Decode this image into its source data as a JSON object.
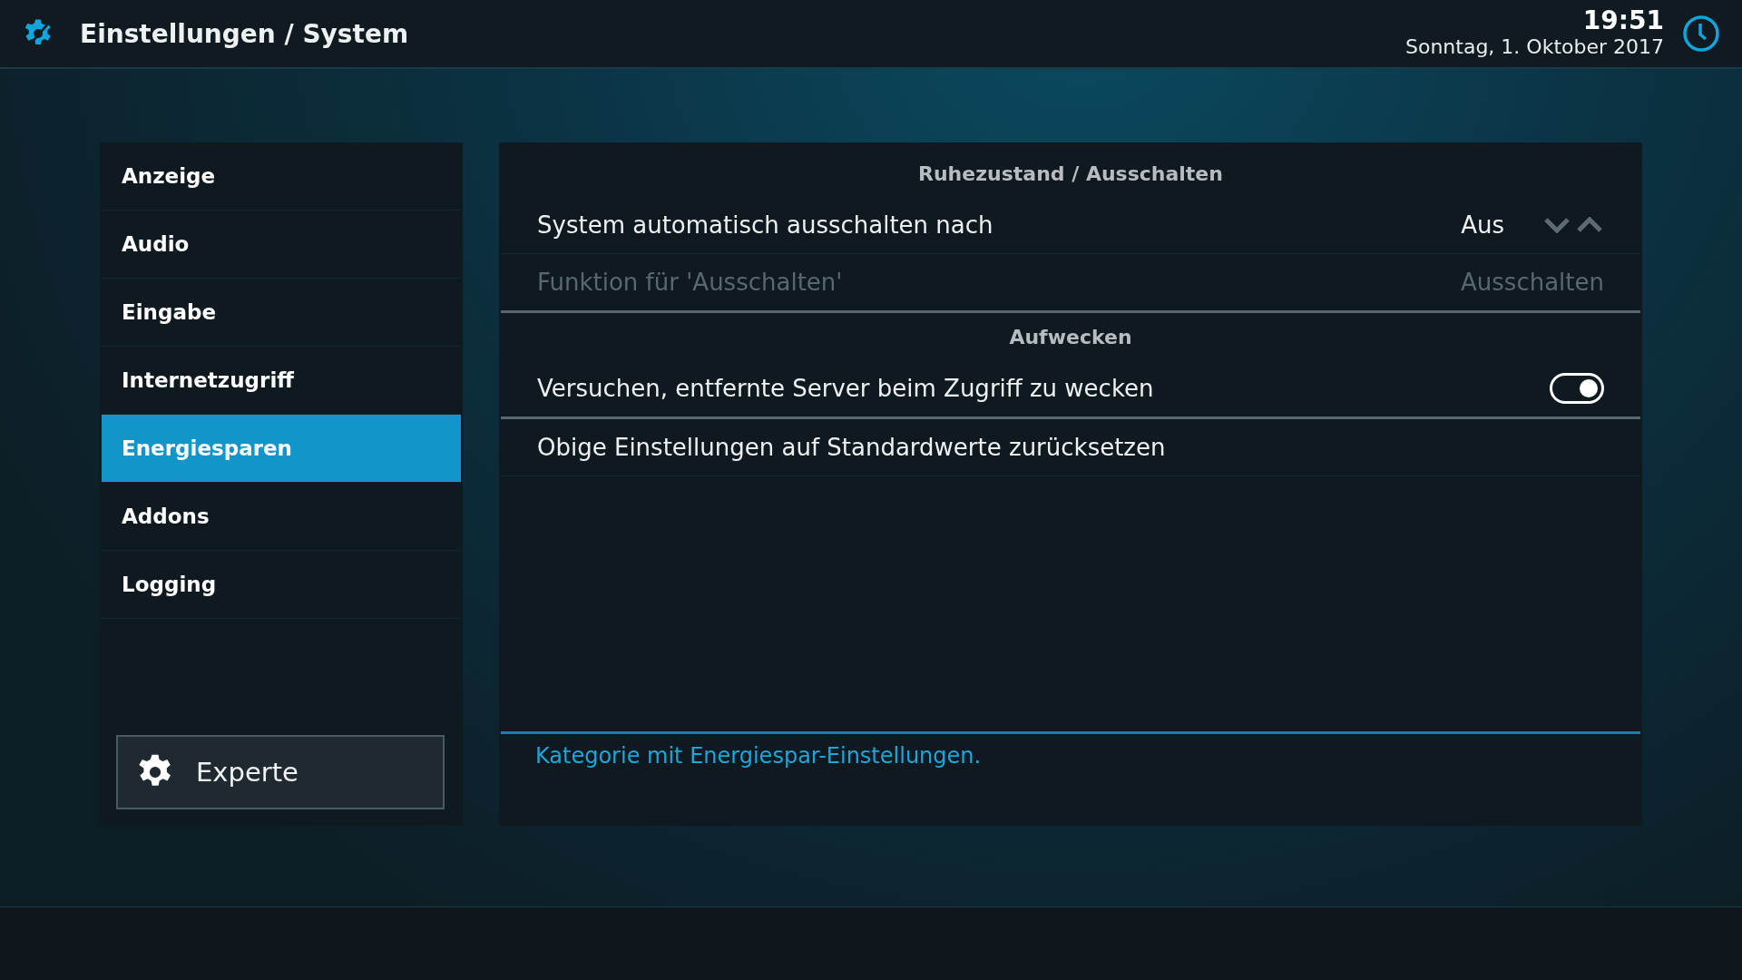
{
  "header": {
    "title": "Einstellungen / System",
    "time": "19:51",
    "date": "Sonntag, 1. Oktober 2017"
  },
  "sidebar": {
    "items": [
      {
        "label": "Anzeige",
        "selected": false
      },
      {
        "label": "Audio",
        "selected": false
      },
      {
        "label": "Eingabe",
        "selected": false
      },
      {
        "label": "Internetzugriff",
        "selected": false
      },
      {
        "label": "Energiesparen",
        "selected": true
      },
      {
        "label": "Addons",
        "selected": false
      },
      {
        "label": "Logging",
        "selected": false
      }
    ],
    "level_button": "Experte"
  },
  "settings": [
    {
      "kind": "group",
      "label": "Ruhezustand / Ausschalten"
    },
    {
      "kind": "spinner",
      "label": "System automatisch ausschalten nach",
      "value": "Aus",
      "disabled": false
    },
    {
      "kind": "value",
      "label": "Funktion für 'Ausschalten'",
      "value": "Ausschalten",
      "disabled": true
    },
    {
      "kind": "group",
      "label": "Aufwecken"
    },
    {
      "kind": "toggle",
      "label": "Versuchen, entfernte Server beim Zugriff zu wecken",
      "on": true,
      "disabled": false
    },
    {
      "kind": "action",
      "label": "Obige Einstellungen auf Standardwerte zurücksetzen",
      "disabled": false
    }
  ],
  "description": "Kategorie mit Energiespar-Einstellungen."
}
